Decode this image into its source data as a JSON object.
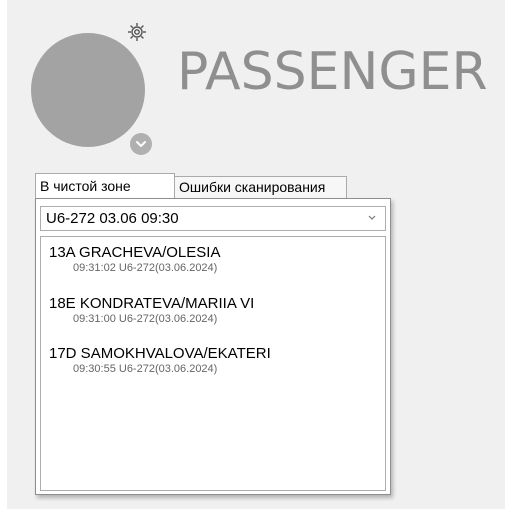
{
  "header": {
    "title": "PASSENGER",
    "icons": {
      "settings": "gear-icon",
      "expand": "chevron-down-icon"
    },
    "avatar_color": "#a3a3a3"
  },
  "tabs": [
    {
      "label": "В чистой зоне",
      "active": true
    },
    {
      "label": "Ошибки сканирования",
      "active": false
    }
  ],
  "flight_select": {
    "value": "U6-272 03.06 09:30"
  },
  "scans": [
    {
      "name": "13A GRACHEVA/OLESIA",
      "meta": "09:31:02 U6-272(03.06.2024)"
    },
    {
      "name": "18E KONDRATEVA/MARIIA VI",
      "meta": "09:31:00 U6-272(03.06.2024)"
    },
    {
      "name": "17D SAMOKHVALOVA/EKATERI",
      "meta": "09:30:55 U6-272(03.06.2024)"
    }
  ]
}
